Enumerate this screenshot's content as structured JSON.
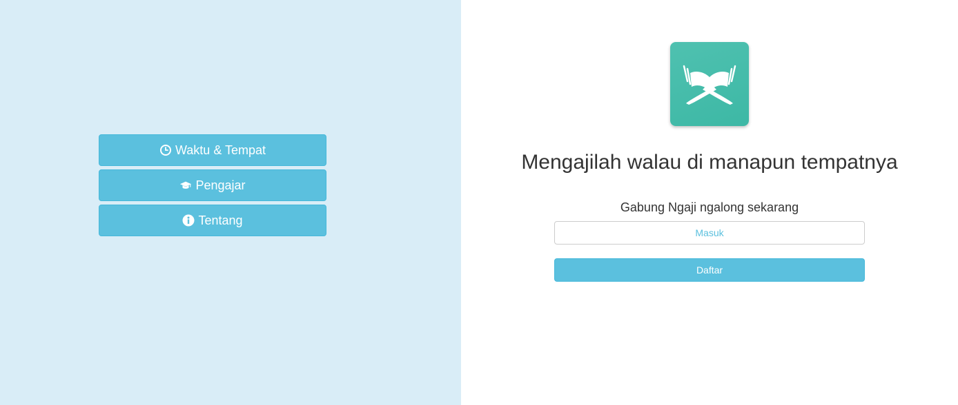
{
  "nav": {
    "items": [
      {
        "label": "Waktu & Tempat",
        "icon": "clock-icon"
      },
      {
        "label": "Pengajar",
        "icon": "graduation-cap-icon"
      },
      {
        "label": "Tentang",
        "icon": "info-circle-icon"
      }
    ]
  },
  "hero": {
    "logo_icon": "quran-book-icon",
    "headline": "Mengajilah walau di manapun tempatnya",
    "join_text": "Gabung Ngaji ngalong sekarang",
    "login_label": "Masuk",
    "register_label": "Daftar"
  },
  "colors": {
    "left_background": "#d9edf7",
    "accent": "#5bc0de",
    "logo_teal": "#42baa8"
  }
}
